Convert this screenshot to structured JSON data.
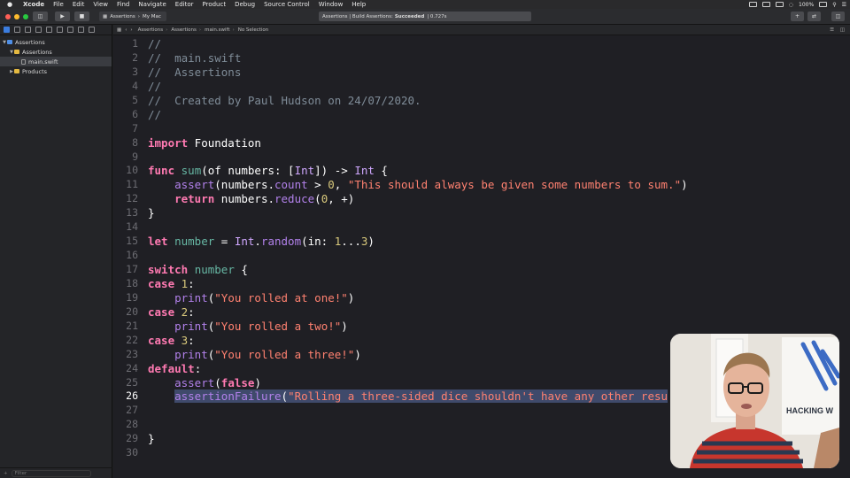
{
  "menubar": {
    "app": "Xcode",
    "items": [
      "File",
      "Edit",
      "View",
      "Find",
      "Navigate",
      "Editor",
      "Product",
      "Debug",
      "Source Control",
      "Window",
      "Help"
    ],
    "battery": "100%"
  },
  "toolbar": {
    "scheme": "Assertions",
    "destination": "My Mac",
    "status_prefix": "Assertions | Build Assertions:",
    "status_result": "Succeeded",
    "status_time": "| 0.727s"
  },
  "navigator": {
    "tree": [
      {
        "label": "Assertions",
        "level": 0,
        "kind": "project",
        "open": true
      },
      {
        "label": "Assertions",
        "level": 1,
        "kind": "folder",
        "open": true
      },
      {
        "label": "main.swift",
        "level": 2,
        "kind": "swift",
        "selected": true
      },
      {
        "label": "Products",
        "level": 1,
        "kind": "folder",
        "open": false
      }
    ],
    "filter_placeholder": "Filter"
  },
  "jumpbar": {
    "crumbs": [
      "Assertions",
      "Assertions",
      "main.swift",
      "No Selection"
    ]
  },
  "editor": {
    "current_line": 26,
    "lines": [
      [
        [
          "c",
          "//"
        ]
      ],
      [
        [
          "c",
          "//  main.swift"
        ]
      ],
      [
        [
          "c",
          "//  Assertions"
        ]
      ],
      [
        [
          "c",
          "//"
        ]
      ],
      [
        [
          "c",
          "//  Created by Paul Hudson on 24/07/2020."
        ]
      ],
      [
        [
          "c",
          "//"
        ]
      ],
      [],
      [
        [
          "k",
          "import"
        ],
        [
          "",
          " Foundation"
        ]
      ],
      [],
      [
        [
          "k",
          "func"
        ],
        [
          "",
          " "
        ],
        [
          "p",
          "sum"
        ],
        [
          "",
          "(of numbers: ["
        ],
        [
          "t",
          "Int"
        ],
        [
          "",
          "]) -> "
        ],
        [
          "t",
          "Int"
        ],
        [
          "",
          " {"
        ]
      ],
      [
        [
          "",
          "    "
        ],
        [
          "f",
          "assert"
        ],
        [
          "",
          "(numbers."
        ],
        [
          "f",
          "count"
        ],
        [
          "",
          " > "
        ],
        [
          "n",
          "0"
        ],
        [
          "",
          ", "
        ],
        [
          "s",
          "\"This should always be given some numbers to sum.\""
        ],
        [
          "",
          ")"
        ]
      ],
      [
        [
          "",
          "    "
        ],
        [
          "k",
          "return"
        ],
        [
          "",
          " numbers."
        ],
        [
          "f",
          "reduce"
        ],
        [
          "",
          "("
        ],
        [
          "n",
          "0"
        ],
        [
          "",
          ", +)"
        ]
      ],
      [
        [
          "",
          "}"
        ]
      ],
      [],
      [
        [
          "k",
          "let"
        ],
        [
          "",
          " "
        ],
        [
          "p",
          "number"
        ],
        [
          "",
          " = "
        ],
        [
          "t",
          "Int"
        ],
        [
          "",
          "."
        ],
        [
          "f",
          "random"
        ],
        [
          "",
          "(in: "
        ],
        [
          "n",
          "1"
        ],
        [
          "",
          "..."
        ],
        [
          "n",
          "3"
        ],
        [
          "",
          ")"
        ]
      ],
      [],
      [
        [
          "k",
          "switch"
        ],
        [
          "",
          " "
        ],
        [
          "p",
          "number"
        ],
        [
          "",
          " {"
        ]
      ],
      [
        [
          "k",
          "case"
        ],
        [
          "",
          " "
        ],
        [
          "n",
          "1"
        ],
        [
          "",
          ":"
        ]
      ],
      [
        [
          "",
          "    "
        ],
        [
          "f",
          "print"
        ],
        [
          "",
          "("
        ],
        [
          "s",
          "\"You rolled at one!\""
        ],
        [
          "",
          ")"
        ]
      ],
      [
        [
          "k",
          "case"
        ],
        [
          "",
          " "
        ],
        [
          "n",
          "2"
        ],
        [
          "",
          ":"
        ]
      ],
      [
        [
          "",
          "    "
        ],
        [
          "f",
          "print"
        ],
        [
          "",
          "("
        ],
        [
          "s",
          "\"You rolled a two!\""
        ],
        [
          "",
          ")"
        ]
      ],
      [
        [
          "k",
          "case"
        ],
        [
          "",
          " "
        ],
        [
          "n",
          "3"
        ],
        [
          "",
          ":"
        ]
      ],
      [
        [
          "",
          "    "
        ],
        [
          "f",
          "print"
        ],
        [
          "",
          "("
        ],
        [
          "s",
          "\"You rolled a three!\""
        ],
        [
          "",
          ")"
        ]
      ],
      [
        [
          "k",
          "default"
        ],
        [
          "",
          ":"
        ]
      ],
      [
        [
          "",
          "    "
        ],
        [
          "f",
          "assert"
        ],
        [
          "",
          "("
        ],
        [
          "k",
          "false"
        ],
        [
          "",
          ")"
        ]
      ],
      [
        [
          "",
          "    "
        ],
        [
          "f",
          "assertionFailure"
        ],
        [
          "",
          "("
        ],
        [
          "s",
          "\"Rolling a three-sided dice shouldn't have any other resu"
        ]
      ],
      [],
      [],
      [
        [
          "",
          "}"
        ]
      ],
      []
    ]
  },
  "webcam": {
    "sign_text": "HACKING W"
  }
}
